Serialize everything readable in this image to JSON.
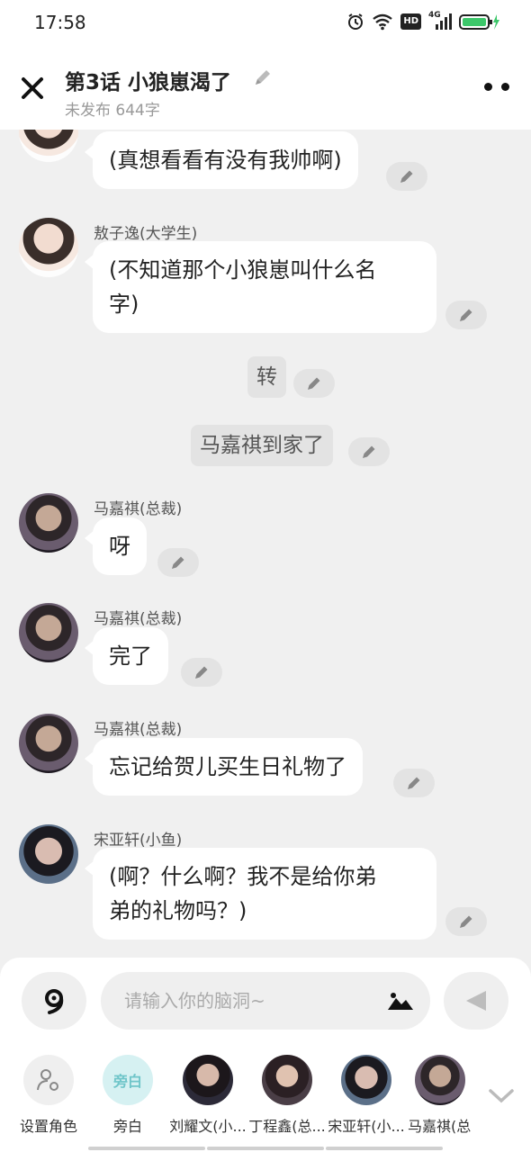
{
  "status_bar": {
    "time": "17:58",
    "network_badge": "HD",
    "signal_label": "4G",
    "battery_color": "#3cc76a"
  },
  "header": {
    "chapter_title": "第3话   小狼崽渴了",
    "meta": "未发布 644字"
  },
  "messages": [
    {
      "type": "dialog",
      "speaker": "",
      "lines": [
        "(真想看看有没有我帅啊)"
      ]
    },
    {
      "type": "dialog",
      "speaker": "敖子逸(大学生)",
      "lines": [
        "(不知道那个小狼崽叫什么名",
        "字)"
      ]
    },
    {
      "type": "narration",
      "text": "转"
    },
    {
      "type": "narration",
      "text": "马嘉祺到家了"
    },
    {
      "type": "dialog",
      "speaker": "马嘉祺(总裁)",
      "lines": [
        "呀"
      ]
    },
    {
      "type": "dialog",
      "speaker": "马嘉祺(总裁)",
      "lines": [
        "完了"
      ]
    },
    {
      "type": "dialog",
      "speaker": "马嘉祺(总裁)",
      "lines": [
        "忘记给贺儿买生日礼物了"
      ]
    },
    {
      "type": "dialog",
      "speaker": "宋亚轩(小鱼)",
      "lines": [
        "(啊？什么啊？我不是给你弟",
        "弟的礼物吗？)"
      ]
    }
  ],
  "composer": {
    "placeholder": "请输入你的脑洞~",
    "value": ""
  },
  "roles": [
    {
      "label": "设置角色",
      "icon": "person-settings-icon"
    },
    {
      "label": "旁白",
      "badge": "旁白"
    },
    {
      "label": "刘耀文(小..."
    },
    {
      "label": "丁程鑫(总..."
    },
    {
      "label": "宋亚轩(小..."
    },
    {
      "label": "马嘉祺(总"
    }
  ]
}
